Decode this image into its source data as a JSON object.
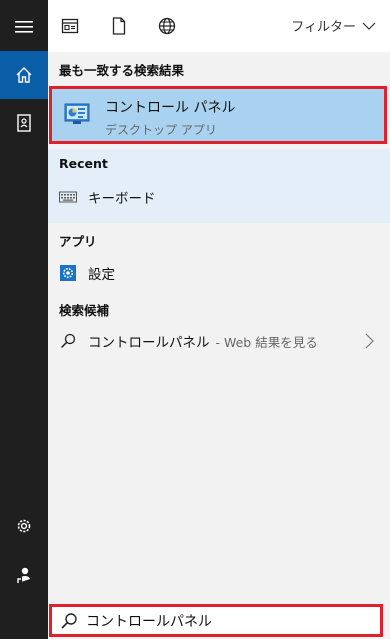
{
  "rail": {
    "icons": [
      "hamburger-icon",
      "home-icon",
      "notebook-icon",
      "gear-icon",
      "user-icon"
    ]
  },
  "topbar": {
    "filter_label": "フィルター"
  },
  "best_match": {
    "heading": "最も一致する検索結果",
    "title": "コントロール パネル",
    "subtitle": "デスクトップ アプリ"
  },
  "recent": {
    "heading": "Recent",
    "items": [
      {
        "label": "キーボード"
      }
    ]
  },
  "apps": {
    "heading": "アプリ",
    "items": [
      {
        "label": "設定"
      }
    ]
  },
  "suggestions": {
    "heading": "検索候補",
    "items": [
      {
        "label": "コントロールパネル",
        "sub": "- Web 結果を見る"
      }
    ]
  },
  "search": {
    "value": "コントロールパネル"
  },
  "colors": {
    "accent": "#0a5fa8",
    "highlight": "#a9d2f1",
    "red_box": "#e0202b"
  }
}
